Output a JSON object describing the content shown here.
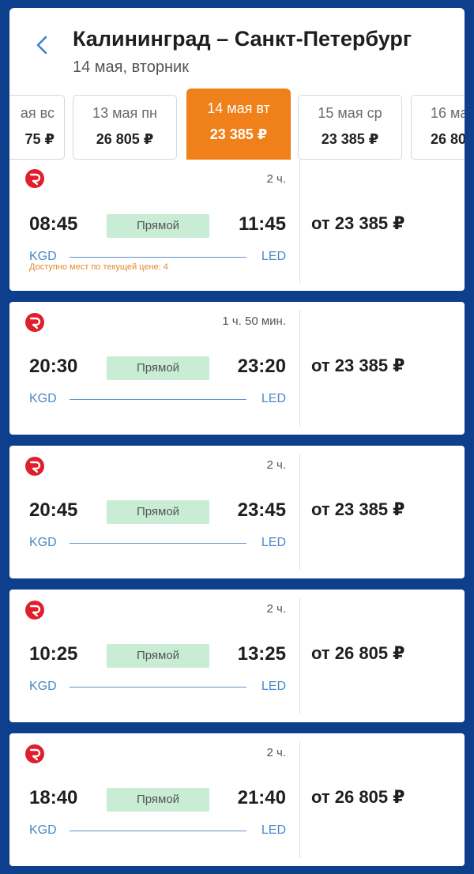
{
  "header": {
    "title": "Калининград – Санкт-Петербург",
    "subtitle": "14 мая, вторник"
  },
  "dates": [
    {
      "date": "ая вс",
      "price": "75 ₽"
    },
    {
      "date": "13 мая пн",
      "price": "26 805 ₽"
    },
    {
      "date": "14 мая вт",
      "price": "23 385 ₽",
      "active": true
    },
    {
      "date": "15 мая ср",
      "price": "23 385 ₽"
    },
    {
      "date": "16 ма",
      "price": "26 80"
    }
  ],
  "flights": [
    {
      "duration": "2 ч.",
      "dep": "08:45",
      "arr": "11:45",
      "type": "Прямой",
      "from": "KGD",
      "to": "LED",
      "price": "от 23 385 ₽",
      "seats_note": "Доступно мест по текущей цене: 4"
    },
    {
      "duration": "1 ч. 50 мин.",
      "dep": "20:30",
      "arr": "23:20",
      "type": "Прямой",
      "from": "KGD",
      "to": "LED",
      "price": "от 23 385 ₽"
    },
    {
      "duration": "2 ч.",
      "dep": "20:45",
      "arr": "23:45",
      "type": "Прямой",
      "from": "KGD",
      "to": "LED",
      "price": "от 23 385 ₽"
    },
    {
      "duration": "2 ч.",
      "dep": "10:25",
      "arr": "13:25",
      "type": "Прямой",
      "from": "KGD",
      "to": "LED",
      "price": "от 26 805 ₽"
    },
    {
      "duration": "2 ч.",
      "dep": "18:40",
      "arr": "21:40",
      "type": "Прямой",
      "from": "KGD",
      "to": "LED",
      "price": "от 26 805 ₽"
    }
  ],
  "colors": {
    "background": "#0d3f8c",
    "accent": "#f08019",
    "badge": "#c9ecd5",
    "airport": "#4a88c8",
    "seats_note": "#e08a2c",
    "airline_logo": "#e01e2d"
  },
  "icons": {
    "back": "chevron-left-icon",
    "airline": "airline-logo-icon"
  }
}
